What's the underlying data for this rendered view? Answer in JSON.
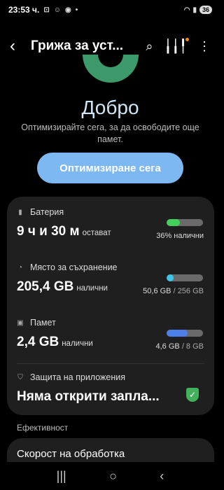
{
  "status_bar": {
    "time": "23:53",
    "time_suffix": "ч.",
    "battery": "36",
    "icons": [
      "screen-record-icon",
      "face-icon",
      "chrome-icon",
      "dot-icon",
      "wifi-icon",
      "signal-icon"
    ]
  },
  "app_bar": {
    "title": "Грижа за уст...",
    "icons": [
      "back-icon",
      "search-icon",
      "diagnostics-icon",
      "more-icon"
    ]
  },
  "hero": {
    "status_word": "Добро",
    "subtitle": "Оптимизирайте сега, за да освободите още памет.",
    "button_label": "Оптимизиране сега",
    "accent": "#3c9a6a"
  },
  "battery": {
    "label": "Батерия",
    "value": "9 ч и 30 м",
    "unit_text": "остават",
    "caption": "36% налични",
    "level": 0.36,
    "color": "#43d05a"
  },
  "storage": {
    "label": "Място за съхранение",
    "value": "205,4 GB",
    "unit_text": "налични",
    "used": "50,6 GB",
    "total": "/ 256 GB",
    "level": 0.2,
    "color": "#3bc6ea"
  },
  "memory": {
    "label": "Памет",
    "value": "2,4 GB",
    "unit_text": "налични",
    "used": "4,6 GB",
    "total": "/ 8 GB",
    "level": 0.575,
    "color": "#4d7fe8"
  },
  "app_protection": {
    "label": "Защита на приложения",
    "value": "Няма открити запла...",
    "color": "#43b05c"
  },
  "efficiency": {
    "section_label": "Ефективност",
    "item_label": "Скорост на обработка"
  },
  "nav": {
    "icons": [
      "recents-icon",
      "home-icon",
      "back-nav-icon"
    ]
  }
}
